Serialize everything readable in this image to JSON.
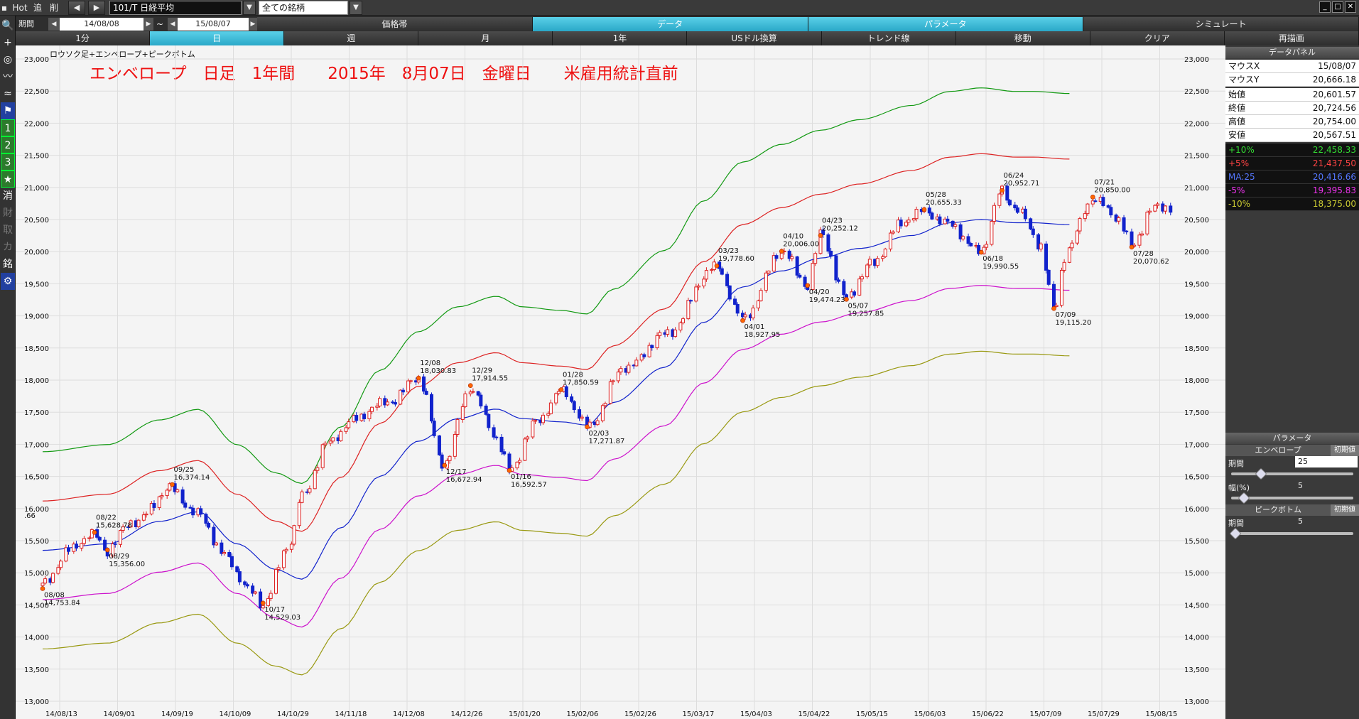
{
  "topbar": {
    "hot": "Hot",
    "add": "追",
    "del": "削",
    "symbol": "101/T 日経平均",
    "universe": "全ての銘柄",
    "period_label": "期間",
    "date_from": "14/08/08",
    "tilde": "~",
    "date_to": "15/08/07"
  },
  "menu_row1": [
    "価格帯",
    "データ",
    "パラメータ",
    "シミュレート"
  ],
  "menu_row1_active": [
    false,
    true,
    true,
    false
  ],
  "menu_row2": [
    "1分",
    "日",
    "週",
    "月",
    "1年",
    "USドル換算",
    "トレンド線",
    "移動",
    "クリア",
    "再描画"
  ],
  "menu_row2_active": [
    false,
    true,
    false,
    false,
    false,
    false,
    false,
    false,
    false,
    false
  ],
  "left_toolbar": [
    {
      "icon": "search-icon",
      "glyph": "🔍",
      "type": "plain"
    },
    {
      "icon": "plus-icon",
      "glyph": "+",
      "type": "plain"
    },
    {
      "icon": "camera-icon",
      "glyph": "◎",
      "type": "plain"
    },
    {
      "icon": "line-chart-icon",
      "glyph": "〰",
      "type": "plain"
    },
    {
      "icon": "indicator-icon",
      "glyph": "≈",
      "type": "plain"
    },
    {
      "icon": "flag-icon",
      "glyph": "⚑",
      "type": "blue"
    },
    {
      "icon": "preset-1-icon",
      "glyph": "1",
      "type": "green"
    },
    {
      "icon": "preset-2-icon",
      "glyph": "2",
      "type": "green"
    },
    {
      "icon": "preset-3-icon",
      "glyph": "3",
      "type": "green"
    },
    {
      "icon": "star-icon",
      "glyph": "★",
      "type": "green"
    },
    {
      "icon": "erase-icon",
      "glyph": "消",
      "type": "plain"
    },
    {
      "icon": "fundamental-icon",
      "glyph": "財",
      "type": "gray"
    },
    {
      "icon": "trade-icon",
      "glyph": "取",
      "type": "gray"
    },
    {
      "icon": "power-icon",
      "glyph": "カ",
      "type": "gray"
    },
    {
      "icon": "stock-icon",
      "glyph": "銘",
      "type": "plain"
    },
    {
      "icon": "gear-icon",
      "glyph": "⚙",
      "type": "blue"
    }
  ],
  "chart": {
    "legend": "ロウソク足+エンベロープ+ピークボトム",
    "title_note": "エンベロープ　日足　1年間　　2015年　8月07日　金曜日　　米雇用統計直前"
  },
  "chart_data": {
    "type": "line",
    "ylim": [
      13000,
      23000
    ],
    "y_ticks": [
      13000,
      13500,
      14000,
      14500,
      15000,
      15500,
      16000,
      16500,
      17000,
      17500,
      18000,
      18500,
      19000,
      19500,
      20000,
      20500,
      21000,
      21500,
      22000,
      22500,
      23000
    ],
    "y_tick_labels": [
      "13,000",
      "13,500",
      "14,000",
      "14,500",
      "15,000",
      "15,500",
      "16,000",
      "16,500",
      "17,000",
      "17,500",
      "18,000",
      "18,500",
      "19,000",
      "19,500",
      "20,000",
      "20,500",
      "21,000",
      "21,500",
      "22,000",
      "22,500",
      "23,000"
    ],
    "x_labels": [
      "14/08/13",
      "14/09/01",
      "14/09/19",
      "14/10/09",
      "14/10/29",
      "14/11/18",
      "14/12/08",
      "14/12/26",
      "15/01/20",
      "15/02/06",
      "15/02/26",
      "15/03/17",
      "15/04/03",
      "15/04/22",
      "15/05/15",
      "15/06/03",
      "15/06/22",
      "15/07/09",
      "15/07/29",
      "15/08/15"
    ],
    "ma_anchors": [
      [
        0,
        15350
      ],
      [
        25,
        15450
      ],
      [
        45,
        15800
      ],
      [
        60,
        15950
      ],
      [
        75,
        15450
      ],
      [
        90,
        15050
      ],
      [
        100,
        14900
      ],
      [
        115,
        15700
      ],
      [
        130,
        16500
      ],
      [
        145,
        17050
      ],
      [
        160,
        17400
      ],
      [
        175,
        17550
      ],
      [
        185,
        17400
      ],
      [
        200,
        17350
      ],
      [
        210,
        17300
      ],
      [
        220,
        17650
      ],
      [
        240,
        18200
      ],
      [
        255,
        18900
      ],
      [
        270,
        19450
      ],
      [
        285,
        19700
      ],
      [
        300,
        19900
      ],
      [
        315,
        20050
      ],
      [
        335,
        20250
      ],
      [
        350,
        20450
      ],
      [
        362,
        20500
      ],
      [
        375,
        20450
      ],
      [
        382,
        20450
      ],
      [
        396,
        20420
      ]
    ],
    "envelopes": [
      {
        "name": "+10%",
        "pct": 10,
        "color": "#119911"
      },
      {
        "name": "+5%",
        "pct": 5,
        "color": "#dd2222"
      },
      {
        "name": "MA:25",
        "pct": 0,
        "color": "#1122cc"
      },
      {
        "name": "-5%",
        "pct": -5,
        "color": "#cc11cc"
      },
      {
        "name": "-10%",
        "pct": -10,
        "color": "#999911"
      }
    ],
    "price_anchors": [
      [
        0,
        14800
      ],
      [
        10,
        15350
      ],
      [
        20,
        15600
      ],
      [
        25,
        15360
      ],
      [
        35,
        15800
      ],
      [
        50,
        16300
      ],
      [
        60,
        15900
      ],
      [
        70,
        15300
      ],
      [
        80,
        14700
      ],
      [
        85,
        14530
      ],
      [
        95,
        15400
      ],
      [
        100,
        16200
      ],
      [
        110,
        17000
      ],
      [
        120,
        17400
      ],
      [
        135,
        17700
      ],
      [
        145,
        18030
      ],
      [
        155,
        16680
      ],
      [
        165,
        17900
      ],
      [
        175,
        17100
      ],
      [
        180,
        16600
      ],
      [
        190,
        17300
      ],
      [
        200,
        17850
      ],
      [
        210,
        17280
      ],
      [
        225,
        18200
      ],
      [
        240,
        18700
      ],
      [
        260,
        19780
      ],
      [
        270,
        18930
      ],
      [
        285,
        20000
      ],
      [
        295,
        19500
      ],
      [
        300,
        20250
      ],
      [
        310,
        19300
      ],
      [
        320,
        19800
      ],
      [
        330,
        20400
      ],
      [
        340,
        20650
      ],
      [
        350,
        20400
      ],
      [
        362,
        20000
      ],
      [
        370,
        20950
      ],
      [
        375,
        20700
      ],
      [
        385,
        20100
      ],
      [
        390,
        19120
      ],
      [
        395,
        20000
      ],
      [
        405,
        20850
      ],
      [
        415,
        20500
      ],
      [
        420,
        20100
      ],
      [
        428,
        20650
      ],
      [
        434,
        20700
      ]
    ],
    "peaks": [
      {
        "date": "08/08",
        "value": "14,753.84",
        "i": 0,
        "v": 14754,
        "pos": "below"
      },
      {
        "date": "08/22",
        "value": "15,628.78",
        "i": 20,
        "v": 15629,
        "pos": "above"
      },
      {
        "date": "08/29",
        "value": "15,356.00",
        "i": 25,
        "v": 15356,
        "pos": "below"
      },
      {
        "date": "09/25",
        "value": "16,374.14",
        "i": 50,
        "v": 16374,
        "pos": "above"
      },
      {
        "date": "10/17",
        "value": "14,529.03",
        "i": 85,
        "v": 14529,
        "pos": "below"
      },
      {
        "date": "12/08",
        "value": "18,030.83",
        "i": 145,
        "v": 18031,
        "pos": "above"
      },
      {
        "date": "12/17",
        "value": "16,672.94",
        "i": 155,
        "v": 16673,
        "pos": "below"
      },
      {
        "date": "12/29",
        "value": "17,914.55",
        "i": 165,
        "v": 17915,
        "pos": "above"
      },
      {
        "date": "01/16",
        "value": "16,592.57",
        "i": 180,
        "v": 16593,
        "pos": "below"
      },
      {
        "date": "01/28",
        "value": "17,850.59",
        "i": 200,
        "v": 17851,
        "pos": "above"
      },
      {
        "date": "02/03",
        "value": "17,271.87",
        "i": 210,
        "v": 17272,
        "pos": "below"
      },
      {
        "date": "03/23",
        "value": "19,778.60",
        "i": 260,
        "v": 19779,
        "pos": "above"
      },
      {
        "date": "04/01",
        "value": "18,927.95",
        "i": 270,
        "v": 18928,
        "pos": "below"
      },
      {
        "date": "04/10",
        "value": "20,006.00",
        "i": 285,
        "v": 20006,
        "pos": "above"
      },
      {
        "date": "04/20",
        "value": "19,474.23",
        "i": 295,
        "v": 19474,
        "pos": "below"
      },
      {
        "date": "04/23",
        "value": "20,252.12",
        "i": 300,
        "v": 20252,
        "pos": "above"
      },
      {
        "date": "05/07",
        "value": "19,257.85",
        "i": 310,
        "v": 19258,
        "pos": "below"
      },
      {
        "date": "05/28",
        "value": "20,655.33",
        "i": 340,
        "v": 20655,
        "pos": "above"
      },
      {
        "date": "06/18",
        "value": "19,990.55",
        "i": 362,
        "v": 19991,
        "pos": "below"
      },
      {
        "date": "06/24",
        "value": "20,952.71",
        "i": 370,
        "v": 20953,
        "pos": "above"
      },
      {
        "date": "07/09",
        "value": "19,115.20",
        "i": 390,
        "v": 19115,
        "pos": "below"
      },
      {
        "date": "07/21",
        "value": "20,850.00",
        "i": 405,
        "v": 20850,
        "pos": "above"
      },
      {
        "date": "07/28",
        "value": "20,070.62",
        "i": 420,
        "v": 20071,
        "pos": "below"
      }
    ],
    "left_partial_label": ".66"
  },
  "data_panel": {
    "header": "データパネル",
    "mouse": [
      {
        "label": "マウスX",
        "value": "15/08/07"
      },
      {
        "label": "マウスY",
        "value": "20,666.18"
      }
    ],
    "ohlc": [
      {
        "label": "始値",
        "value": "20,601.57"
      },
      {
        "label": "終値",
        "value": "20,724.56"
      },
      {
        "label": "高値",
        "value": "20,754.00"
      },
      {
        "label": "安値",
        "value": "20,567.51"
      }
    ],
    "env": [
      {
        "label": "+10%",
        "value": "22,458.33",
        "color": "#33dd33"
      },
      {
        "label": "+5%",
        "value": "21,437.50",
        "color": "#ff4444"
      },
      {
        "label": "MA:25",
        "value": "20,416.66",
        "color": "#5577ff"
      },
      {
        "label": "-5%",
        "value": "19,395.83",
        "color": "#ee33ee"
      },
      {
        "label": "-10%",
        "value": "18,375.00",
        "color": "#cccc33"
      }
    ]
  },
  "param_panel": {
    "header": "パラメータ",
    "envelope_section": "エンベロープ",
    "reset": "初期値",
    "period_label": "期間",
    "period_value": "25",
    "width_label": "幅(%)",
    "width_value": "5",
    "peak_section": "ピークボトム",
    "peak_period_label": "期間",
    "peak_period_value": "5"
  },
  "window_controls": [
    "_",
    "□",
    "✕"
  ]
}
